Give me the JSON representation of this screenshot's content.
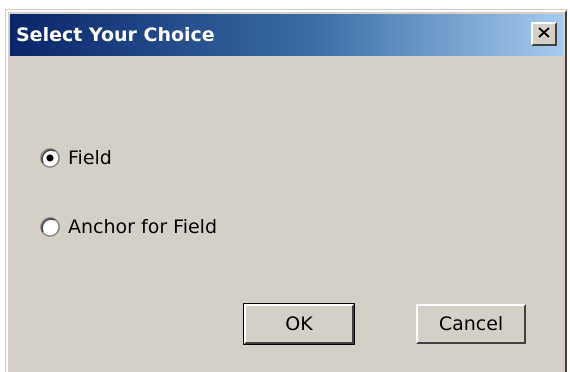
{
  "dialog": {
    "title": "Select Your Choice",
    "close_glyph": "✕",
    "title_gradient": [
      "#0a246a",
      "#a6caf0"
    ],
    "face_color": "#d4d0c8"
  },
  "options": [
    {
      "label": "Field",
      "selected": true
    },
    {
      "label": "Anchor for Field",
      "selected": false
    }
  ],
  "buttons": {
    "ok_label": "OK",
    "cancel_label": "Cancel"
  }
}
